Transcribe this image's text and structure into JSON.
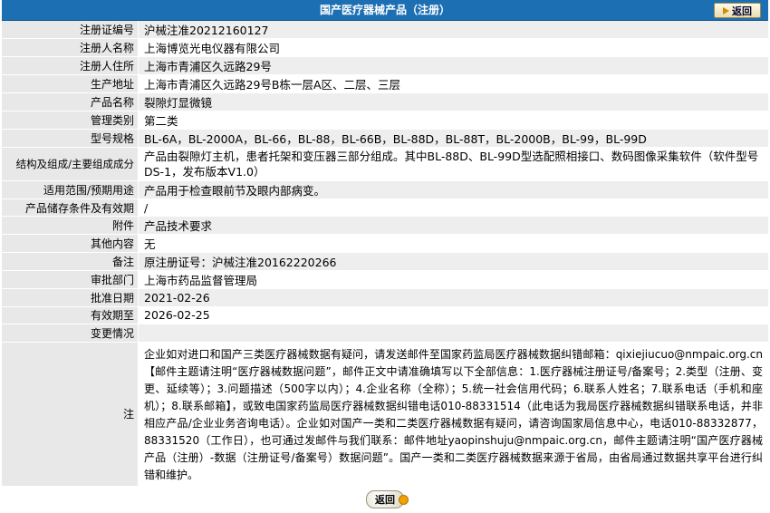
{
  "header": {
    "title": "国产医疗器械产品（注册）",
    "back_label": "返回"
  },
  "rows": [
    {
      "label": "注册证编号",
      "value": "沪械注准20212160127"
    },
    {
      "label": "注册人名称",
      "value": "上海博览光电仪器有限公司"
    },
    {
      "label": "注册人住所",
      "value": "上海市青浦区久远路29号"
    },
    {
      "label": "生产地址",
      "value": "上海市青浦区久远路29号B栋一层A区、二层、三层"
    },
    {
      "label": "产品名称",
      "value": "裂隙灯显微镜"
    },
    {
      "label": "管理类别",
      "value": "第二类"
    },
    {
      "label": "型号规格",
      "value": "BL-6A，BL-2000A，BL-66，BL-88，BL-66B，BL-88D，BL-88T，BL-2000B，BL-99，BL-99D"
    },
    {
      "label": "结构及组成/主要组成成分",
      "value": "产品由裂隙灯主机，患者托架和变压器三部分组成。其中BL-88D、BL-99D型选配照相接口、数码图像采集软件（软件型号DS-1，发布版本V1.0）"
    },
    {
      "label": "适用范围/预期用途",
      "value": "产品用于检查眼前节及眼内部病变。"
    },
    {
      "label": "产品储存条件及有效期",
      "value": "/"
    },
    {
      "label": "附件",
      "value": "产品技术要求"
    },
    {
      "label": "其他内容",
      "value": "无"
    },
    {
      "label": "备注",
      "value": "原注册证号：沪械注准20162220266"
    },
    {
      "label": "审批部门",
      "value": "上海市药品监督管理局"
    },
    {
      "label": "批准日期",
      "value": "2021-02-26"
    },
    {
      "label": "有效期至",
      "value": "2026-02-25"
    },
    {
      "label": "变更情况",
      "value": ""
    }
  ],
  "note": {
    "label": "注",
    "text": "企业如对进口和国产三类医疗器械数据有疑问，请发送邮件至国家药监局医疗器械数据纠错邮箱：qixiejiucuo@nmpaic.org.cn【邮件主题请注明“医疗器械数据问题”，邮件正文中请准确填写以下全部信息：1.医疗器械注册证号/备案号；2.类型（注册、变更、延续等）；3.问题描述（500字以内）；4.企业名称（全称）；5.统一社会信用代码；6.联系人姓名；7.联系电话（手机和座机）；8.联系邮箱】，或致电国家药监局医疗器械数据纠错电话010-88331514（此电话为我局医疗器械数据纠错联系电话，并非相应产品/企业业务咨询电话）。企业如对国产一类和二类医疗器械数据有疑问，请咨询国家局信息中心，电话010-88332877，88331520（工作日），也可通过发邮件与我们联系：邮件地址yaopinshuju@nmpaic.org.cn，邮件主题请注明“国产医疗器械产品（注册）-数据（注册证号/备案号）数据问题”。国产一类和二类医疗器械数据来源于省局，由省局通过数据共享平台进行纠错和维护。"
  },
  "footer": {
    "back_label": "返回"
  }
}
